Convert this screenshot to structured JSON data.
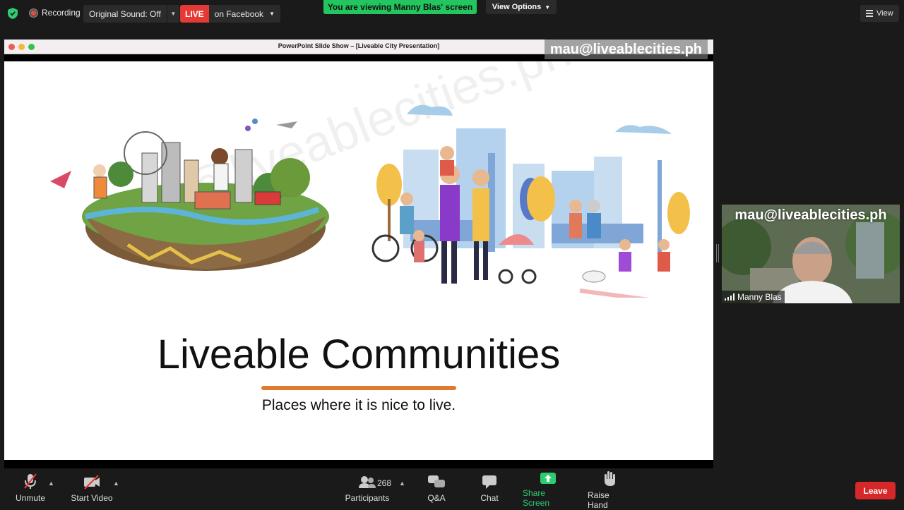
{
  "topbar": {
    "recording_label": "Recording",
    "sound_label": "Original Sound: Off",
    "live_tag": "LIVE",
    "live_platform": "on Facebook",
    "viewing_banner": "You are viewing Manny Blas' screen",
    "view_options_label": "View Options",
    "view_label": "View"
  },
  "share": {
    "window_title": "PowerPoint Slide Show – [Liveable City Presentation]",
    "watermark": "mau@liveablecities.ph"
  },
  "slide": {
    "diagonal_watermark": "mau@liveablecities.ph",
    "title": "Liveable Communities",
    "subtitle": "Places where it is nice to live."
  },
  "video": {
    "watermark": "mau@liveablecities.ph",
    "participant_name": "Manny Blas"
  },
  "toolbar": {
    "unmute": "Unmute",
    "start_video": "Start Video",
    "participants": "Participants",
    "participant_count": "268",
    "qa": "Q&A",
    "chat": "Chat",
    "share_screen": "Share Screen",
    "raise_hand": "Raise Hand",
    "leave": "Leave"
  },
  "colors": {
    "accent_green": "#23c55e",
    "live_red": "#e53935",
    "leave_red": "#d62828",
    "underline_orange": "#e07a30"
  }
}
